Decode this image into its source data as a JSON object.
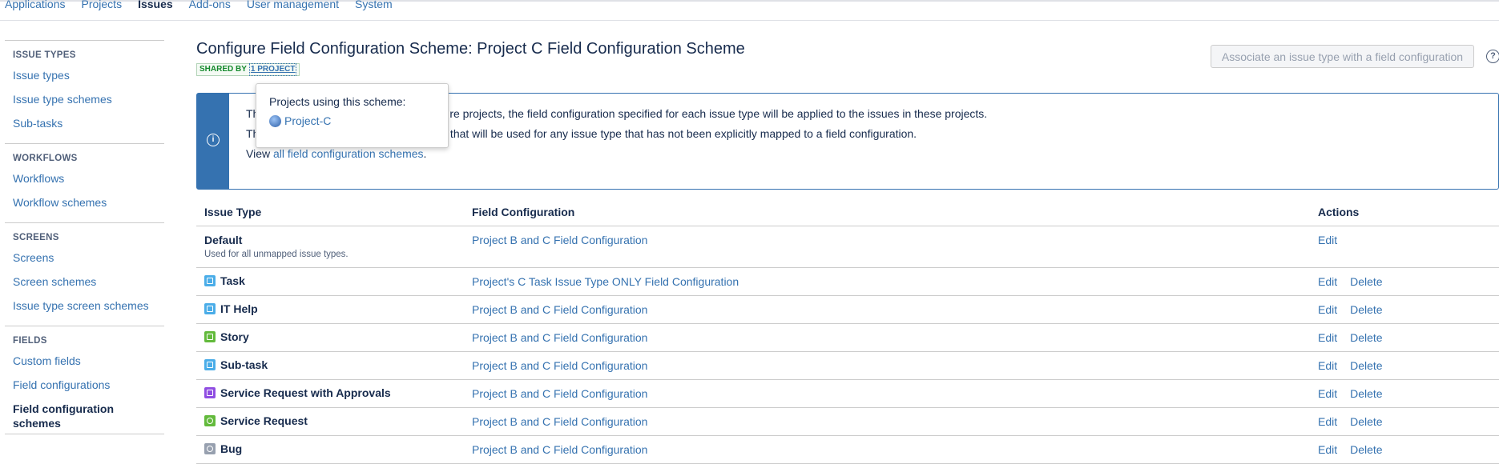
{
  "topnav": {
    "tabs": [
      "Applications",
      "Projects",
      "Issues",
      "Add-ons",
      "User management",
      "System"
    ],
    "active": "Issues"
  },
  "sidebar": {
    "sections": [
      {
        "heading": "ISSUE TYPES",
        "items": [
          "Issue types",
          "Issue type schemes",
          "Sub-tasks"
        ]
      },
      {
        "heading": "WORKFLOWS",
        "items": [
          "Workflows",
          "Workflow schemes"
        ]
      },
      {
        "heading": "SCREENS",
        "items": [
          "Screens",
          "Screen schemes",
          "Issue type screen schemes"
        ]
      },
      {
        "heading": "FIELDS",
        "items": [
          "Custom fields",
          "Field configurations",
          "Field configuration schemes"
        ]
      }
    ],
    "active_item": "Field configuration schemes"
  },
  "page": {
    "title": "Configure Field Configuration Scheme: Project C Field Configuration Scheme",
    "shared_by": "SHARED BY",
    "shared_link": "1 PROJECT",
    "associate_button": "Associate an issue type with a field configuration",
    "help_icon": "?"
  },
  "info": {
    "line1": "Th                                             re projects, the field configuration specified for each issue type will be applied to the issues in these projects.",
    "line1_visible": "re projects, the field configuration specified for each issue type will be applied to the issues in these projects.",
    "line2_visible": "iguration that will be used for any issue type that has not been explicitly mapped to a field configuration.",
    "line1_prefix": "Th",
    "line2_prefix": "Th",
    "view_prefix": "View ",
    "view_link": "all field configuration schemes",
    "view_suffix": "."
  },
  "popup": {
    "title": "Projects using this scheme:",
    "project": "Project-C"
  },
  "table": {
    "headers": [
      "Issue Type",
      "Field Configuration",
      "Actions"
    ],
    "default_row": {
      "name": "Default",
      "sub": "Used for all unmapped issue types.",
      "config": "Project B and C Field Configuration",
      "edit": "Edit"
    },
    "rows": [
      {
        "name": "Task",
        "icon": "task-icon",
        "color": "#4bade8",
        "config": "Project's C Task Issue Type ONLY Field Configuration",
        "edit": "Edit",
        "delete": "Delete"
      },
      {
        "name": "IT Help",
        "icon": "it-help-icon",
        "color": "#4bade8",
        "config": "Project B and C Field Configuration",
        "edit": "Edit",
        "delete": "Delete"
      },
      {
        "name": "Story",
        "icon": "story-icon",
        "color": "#63ba3c",
        "config": "Project B and C Field Configuration",
        "edit": "Edit",
        "delete": "Delete"
      },
      {
        "name": "Sub-task",
        "icon": "subtask-icon",
        "color": "#4bade8",
        "config": "Project B and C Field Configuration",
        "edit": "Edit",
        "delete": "Delete"
      },
      {
        "name": "Service Request with Approvals",
        "icon": "service-request-approvals-icon",
        "color": "#904ee2",
        "config": "Project B and C Field Configuration",
        "edit": "Edit",
        "delete": "Delete"
      },
      {
        "name": "Service Request",
        "icon": "service-request-icon",
        "color": "#63ba3c",
        "config": "Project B and C Field Configuration",
        "edit": "Edit",
        "delete": "Delete"
      },
      {
        "name": "Bug",
        "icon": "bug-icon",
        "color": "#97a0af",
        "config": "Project B and C Field Configuration",
        "edit": "Edit",
        "delete": "Delete"
      }
    ]
  }
}
